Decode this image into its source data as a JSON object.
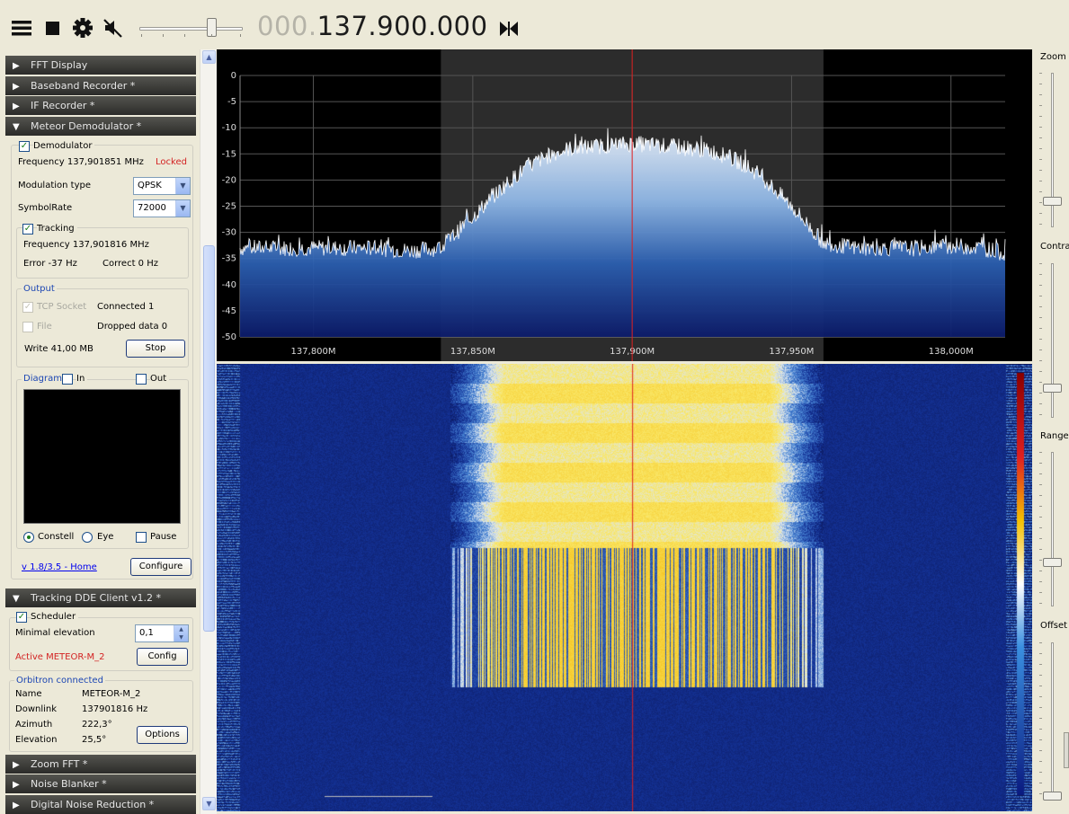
{
  "toolbar": {
    "icons": [
      "menu-icon",
      "stop-icon",
      "gear-icon",
      "mute-icon",
      "tune-icon"
    ],
    "volume_level": 0.7,
    "frequency_dim": "000.",
    "frequency_main": "137.900.000"
  },
  "sidebar": {
    "headers": {
      "fft_display": "FFT Display",
      "baseband_recorder": "Baseband Recorder *",
      "if_recorder": "IF Recorder *",
      "meteor_demodulator": "Meteor Demodulator *",
      "tracking_dde": "Tracking DDE Client v1.2 *",
      "zoom_fft": "Zoom FFT *",
      "noise_blanker": "Noise Blanker *",
      "digital_noise_reduction": "Digital Noise Reduction *"
    },
    "demod": {
      "demodulator_label": "Demodulator",
      "frequency": "Frequency 137,901851 MHz",
      "status": "Locked",
      "modulation_label": "Modulation type",
      "modulation_value": "QPSK",
      "symbolrate_label": "SymbolRate",
      "symbolrate_value": "72000",
      "tracking_label": "Tracking",
      "tracking_freq": "Frequency 137,901816 MHz",
      "error": "Error -37 Hz",
      "correct": "Correct 0 Hz",
      "output_label": "Output",
      "tcp_label": "TCP Socket",
      "connected": "Connected 1",
      "file_label": "File",
      "dropped": "Dropped data 0",
      "write": "Write 41,00 MB",
      "stop_button": "Stop",
      "diagram_label": "Diagram",
      "in_label": "In",
      "out_label": "Out",
      "constell_label": "Constell",
      "eye_label": "Eye",
      "pause_label": "Pause",
      "version_link": "v 1.8/3.5 - Home",
      "configure_button": "Configure"
    },
    "tracking": {
      "scheduler_label": "Scheduler",
      "min_elev_label": "Minimal elevation",
      "min_elev_value": "0,1",
      "active": "Active METEOR-M_2",
      "config_button": "Config",
      "orbitron": "Orbitron connected",
      "name_label": "Name",
      "name_value": "METEOR-M_2",
      "downlink_label": "Downlink",
      "downlink_value": "137901816 Hz",
      "azimuth_label": "Azimuth",
      "azimuth_value": "222,3°",
      "elevation_label": "Elevation",
      "elevation_value": "25,5°",
      "options_button": "Options"
    }
  },
  "right_controls": {
    "zoom": "Zoom",
    "contrast": "Contrast",
    "range": "Range",
    "offset": "Offset"
  },
  "chart_data": {
    "type": "line",
    "y_ticks": [
      "0",
      "-5",
      "-10",
      "-15",
      "-20",
      "-25",
      "-30",
      "-35",
      "-40",
      "-45",
      "-50"
    ],
    "ylim": [
      -50,
      0
    ],
    "x_ticks": [
      "137,800M",
      "137,850M",
      "137,900M",
      "137,950M",
      "138,000M"
    ],
    "xlim": [
      137.777,
      138.017
    ],
    "center_frequency": 137.9,
    "filter_band": [
      137.84,
      137.96
    ],
    "noise_floor_db": -33,
    "signal_peak_db": -13,
    "grid": true,
    "x": [
      137.777,
      137.79,
      137.8,
      137.81,
      137.82,
      137.83,
      137.84,
      137.845,
      137.85,
      137.855,
      137.86,
      137.865,
      137.87,
      137.875,
      137.88,
      137.89,
      137.9,
      137.91,
      137.92,
      137.925,
      137.93,
      137.935,
      137.94,
      137.945,
      137.95,
      137.955,
      137.96,
      137.97,
      137.98,
      137.99,
      138.0,
      138.01,
      138.017
    ],
    "y": [
      -33,
      -33,
      -33,
      -33,
      -33,
      -33.5,
      -33,
      -30,
      -27,
      -24,
      -21,
      -18.5,
      -16.5,
      -15,
      -14,
      -13.5,
      -13,
      -13.5,
      -14,
      -14.5,
      -15.5,
      -17,
      -19,
      -22,
      -25,
      -28.5,
      -32,
      -33,
      -33,
      -33,
      -32.5,
      -33,
      -34
    ]
  }
}
